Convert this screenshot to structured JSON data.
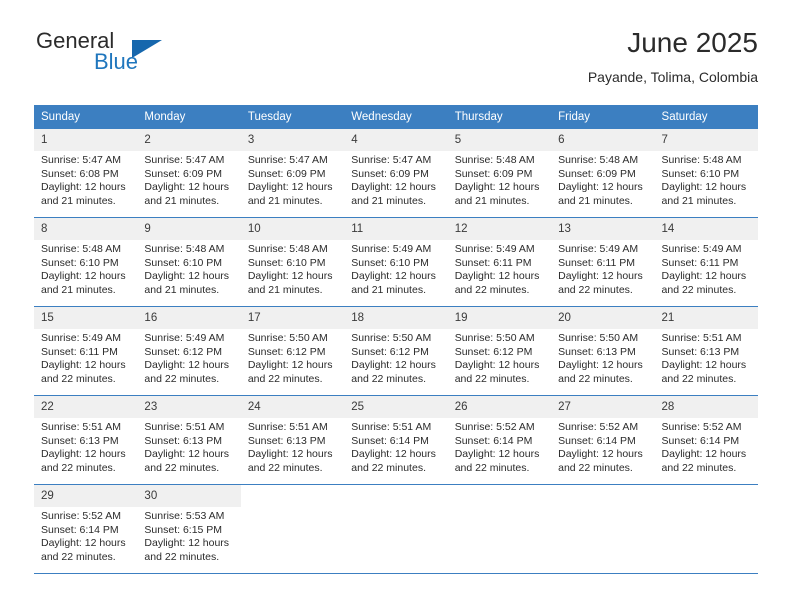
{
  "brand": {
    "name_part1": "General",
    "name_part2": "Blue",
    "triangle_color": "#1667ad",
    "blue_color": "#1f76bd"
  },
  "header": {
    "month_title": "June 2025",
    "location": "Payande, Tolima, Colombia"
  },
  "theme": {
    "header_bg": "#3c7fc1",
    "header_text": "#ffffff",
    "daynum_bg": "#f0f0f0",
    "grid_line": "#3c7fc1",
    "body_text": "#2b2b2b"
  },
  "calendar": {
    "weekday_headers": [
      "Sunday",
      "Monday",
      "Tuesday",
      "Wednesday",
      "Thursday",
      "Friday",
      "Saturday"
    ],
    "weeks": [
      [
        {
          "day": "1",
          "sunrise": "Sunrise: 5:47 AM",
          "sunset": "Sunset: 6:08 PM",
          "daylight_line1": "Daylight: 12 hours",
          "daylight_line2": "and 21 minutes."
        },
        {
          "day": "2",
          "sunrise": "Sunrise: 5:47 AM",
          "sunset": "Sunset: 6:09 PM",
          "daylight_line1": "Daylight: 12 hours",
          "daylight_line2": "and 21 minutes."
        },
        {
          "day": "3",
          "sunrise": "Sunrise: 5:47 AM",
          "sunset": "Sunset: 6:09 PM",
          "daylight_line1": "Daylight: 12 hours",
          "daylight_line2": "and 21 minutes."
        },
        {
          "day": "4",
          "sunrise": "Sunrise: 5:47 AM",
          "sunset": "Sunset: 6:09 PM",
          "daylight_line1": "Daylight: 12 hours",
          "daylight_line2": "and 21 minutes."
        },
        {
          "day": "5",
          "sunrise": "Sunrise: 5:48 AM",
          "sunset": "Sunset: 6:09 PM",
          "daylight_line1": "Daylight: 12 hours",
          "daylight_line2": "and 21 minutes."
        },
        {
          "day": "6",
          "sunrise": "Sunrise: 5:48 AM",
          "sunset": "Sunset: 6:09 PM",
          "daylight_line1": "Daylight: 12 hours",
          "daylight_line2": "and 21 minutes."
        },
        {
          "day": "7",
          "sunrise": "Sunrise: 5:48 AM",
          "sunset": "Sunset: 6:10 PM",
          "daylight_line1": "Daylight: 12 hours",
          "daylight_line2": "and 21 minutes."
        }
      ],
      [
        {
          "day": "8",
          "sunrise": "Sunrise: 5:48 AM",
          "sunset": "Sunset: 6:10 PM",
          "daylight_line1": "Daylight: 12 hours",
          "daylight_line2": "and 21 minutes."
        },
        {
          "day": "9",
          "sunrise": "Sunrise: 5:48 AM",
          "sunset": "Sunset: 6:10 PM",
          "daylight_line1": "Daylight: 12 hours",
          "daylight_line2": "and 21 minutes."
        },
        {
          "day": "10",
          "sunrise": "Sunrise: 5:48 AM",
          "sunset": "Sunset: 6:10 PM",
          "daylight_line1": "Daylight: 12 hours",
          "daylight_line2": "and 21 minutes."
        },
        {
          "day": "11",
          "sunrise": "Sunrise: 5:49 AM",
          "sunset": "Sunset: 6:10 PM",
          "daylight_line1": "Daylight: 12 hours",
          "daylight_line2": "and 21 minutes."
        },
        {
          "day": "12",
          "sunrise": "Sunrise: 5:49 AM",
          "sunset": "Sunset: 6:11 PM",
          "daylight_line1": "Daylight: 12 hours",
          "daylight_line2": "and 22 minutes."
        },
        {
          "day": "13",
          "sunrise": "Sunrise: 5:49 AM",
          "sunset": "Sunset: 6:11 PM",
          "daylight_line1": "Daylight: 12 hours",
          "daylight_line2": "and 22 minutes."
        },
        {
          "day": "14",
          "sunrise": "Sunrise: 5:49 AM",
          "sunset": "Sunset: 6:11 PM",
          "daylight_line1": "Daylight: 12 hours",
          "daylight_line2": "and 22 minutes."
        }
      ],
      [
        {
          "day": "15",
          "sunrise": "Sunrise: 5:49 AM",
          "sunset": "Sunset: 6:11 PM",
          "daylight_line1": "Daylight: 12 hours",
          "daylight_line2": "and 22 minutes."
        },
        {
          "day": "16",
          "sunrise": "Sunrise: 5:49 AM",
          "sunset": "Sunset: 6:12 PM",
          "daylight_line1": "Daylight: 12 hours",
          "daylight_line2": "and 22 minutes."
        },
        {
          "day": "17",
          "sunrise": "Sunrise: 5:50 AM",
          "sunset": "Sunset: 6:12 PM",
          "daylight_line1": "Daylight: 12 hours",
          "daylight_line2": "and 22 minutes."
        },
        {
          "day": "18",
          "sunrise": "Sunrise: 5:50 AM",
          "sunset": "Sunset: 6:12 PM",
          "daylight_line1": "Daylight: 12 hours",
          "daylight_line2": "and 22 minutes."
        },
        {
          "day": "19",
          "sunrise": "Sunrise: 5:50 AM",
          "sunset": "Sunset: 6:12 PM",
          "daylight_line1": "Daylight: 12 hours",
          "daylight_line2": "and 22 minutes."
        },
        {
          "day": "20",
          "sunrise": "Sunrise: 5:50 AM",
          "sunset": "Sunset: 6:13 PM",
          "daylight_line1": "Daylight: 12 hours",
          "daylight_line2": "and 22 minutes."
        },
        {
          "day": "21",
          "sunrise": "Sunrise: 5:51 AM",
          "sunset": "Sunset: 6:13 PM",
          "daylight_line1": "Daylight: 12 hours",
          "daylight_line2": "and 22 minutes."
        }
      ],
      [
        {
          "day": "22",
          "sunrise": "Sunrise: 5:51 AM",
          "sunset": "Sunset: 6:13 PM",
          "daylight_line1": "Daylight: 12 hours",
          "daylight_line2": "and 22 minutes."
        },
        {
          "day": "23",
          "sunrise": "Sunrise: 5:51 AM",
          "sunset": "Sunset: 6:13 PM",
          "daylight_line1": "Daylight: 12 hours",
          "daylight_line2": "and 22 minutes."
        },
        {
          "day": "24",
          "sunrise": "Sunrise: 5:51 AM",
          "sunset": "Sunset: 6:13 PM",
          "daylight_line1": "Daylight: 12 hours",
          "daylight_line2": "and 22 minutes."
        },
        {
          "day": "25",
          "sunrise": "Sunrise: 5:51 AM",
          "sunset": "Sunset: 6:14 PM",
          "daylight_line1": "Daylight: 12 hours",
          "daylight_line2": "and 22 minutes."
        },
        {
          "day": "26",
          "sunrise": "Sunrise: 5:52 AM",
          "sunset": "Sunset: 6:14 PM",
          "daylight_line1": "Daylight: 12 hours",
          "daylight_line2": "and 22 minutes."
        },
        {
          "day": "27",
          "sunrise": "Sunrise: 5:52 AM",
          "sunset": "Sunset: 6:14 PM",
          "daylight_line1": "Daylight: 12 hours",
          "daylight_line2": "and 22 minutes."
        },
        {
          "day": "28",
          "sunrise": "Sunrise: 5:52 AM",
          "sunset": "Sunset: 6:14 PM",
          "daylight_line1": "Daylight: 12 hours",
          "daylight_line2": "and 22 minutes."
        }
      ],
      [
        {
          "day": "29",
          "sunrise": "Sunrise: 5:52 AM",
          "sunset": "Sunset: 6:14 PM",
          "daylight_line1": "Daylight: 12 hours",
          "daylight_line2": "and 22 minutes."
        },
        {
          "day": "30",
          "sunrise": "Sunrise: 5:53 AM",
          "sunset": "Sunset: 6:15 PM",
          "daylight_line1": "Daylight: 12 hours",
          "daylight_line2": "and 22 minutes."
        },
        {
          "day": "",
          "sunrise": "",
          "sunset": "",
          "daylight_line1": "",
          "daylight_line2": ""
        },
        {
          "day": "",
          "sunrise": "",
          "sunset": "",
          "daylight_line1": "",
          "daylight_line2": ""
        },
        {
          "day": "",
          "sunrise": "",
          "sunset": "",
          "daylight_line1": "",
          "daylight_line2": ""
        },
        {
          "day": "",
          "sunrise": "",
          "sunset": "",
          "daylight_line1": "",
          "daylight_line2": ""
        },
        {
          "day": "",
          "sunrise": "",
          "sunset": "",
          "daylight_line1": "",
          "daylight_line2": ""
        }
      ]
    ]
  }
}
